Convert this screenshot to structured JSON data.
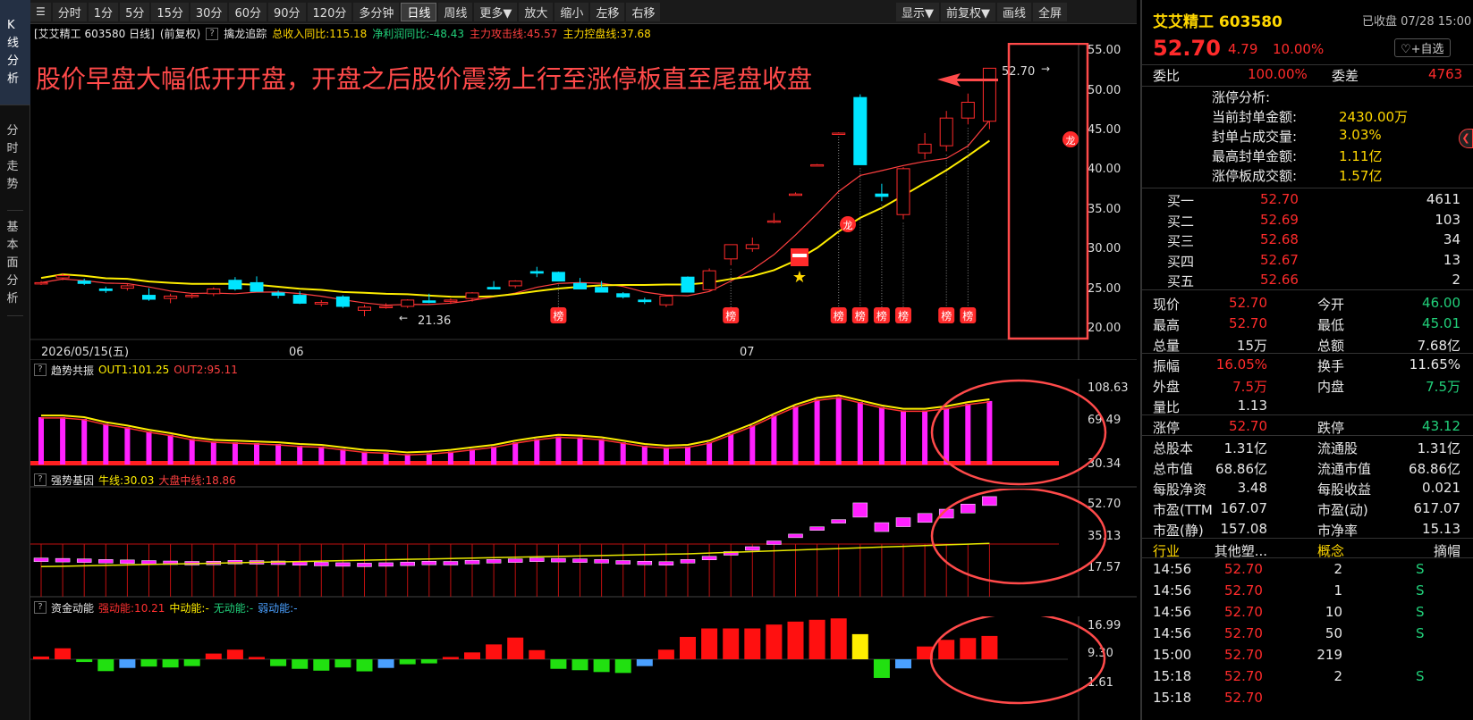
{
  "sidebar": {
    "tabs": [
      "K线分析",
      "分时走势",
      "基本面分析"
    ]
  },
  "toolbar": {
    "left": [
      "分时",
      "1分",
      "5分",
      "15分",
      "30分",
      "60分",
      "90分",
      "120分",
      "多分钟",
      "日线",
      "周线",
      "更多▼",
      "放大",
      "缩小",
      "左移",
      "右移"
    ],
    "active": "日线",
    "right": [
      "显示▼",
      "前复权▼",
      "画线",
      "全屏"
    ]
  },
  "info": {
    "title": "[艾艾精工 603580 日线]",
    "fq": "(前复权)",
    "indicator": "擒龙追踪",
    "rev": "总收入同比:115.18",
    "profit": "净利润同比:-48.43",
    "attack": "主力攻击线:45.57",
    "control": "主力控盘线:37.68"
  },
  "annotation": "股价早盘大幅低开开盘，开盘之后股价震荡上行至涨停板直至尾盘收盘",
  "main_chart": {
    "yaxis": [
      "55.00",
      "50.00",
      "45.00",
      "40.00",
      "35.00",
      "30.00",
      "25.00",
      "20.00"
    ],
    "date": "2026/05/15(五)",
    "months": [
      "06",
      "07"
    ],
    "high_label": "52.70",
    "low_label": "21.36",
    "badge": "榜"
  },
  "panel1": {
    "name": "趋势共振",
    "out1": "OUT1:101.25",
    "out2": "OUT2:95.11",
    "yaxis": [
      "108.63",
      "69.49",
      "30.34"
    ]
  },
  "panel2": {
    "name": "强势基因",
    "bull": "牛线:30.03",
    "mid": "大盘中线:18.86",
    "yaxis": [
      "52.70",
      "35.13",
      "17.57"
    ]
  },
  "panel3": {
    "name": "资金动能",
    "strong": "强动能:10.21",
    "medium": "中动能:-",
    "none": "无动能:-",
    "weak": "弱动能:-",
    "yaxis": [
      "16.99",
      "9.30",
      "1.61"
    ]
  },
  "chart_data": {
    "type": "candlestick",
    "candles": [
      [
        25.5,
        25.8,
        25.3,
        25.6
      ],
      [
        26.2,
        26.8,
        25.9,
        26.5
      ],
      [
        25.8,
        26.1,
        25.3,
        25.5
      ],
      [
        24.8,
        25.1,
        24.3,
        24.6
      ],
      [
        24.9,
        25.4,
        24.6,
        25.2
      ],
      [
        24.0,
        24.9,
        23.3,
        23.5
      ],
      [
        23.6,
        24.2,
        23.0,
        23.9
      ],
      [
        23.9,
        24.3,
        23.6,
        24.0
      ],
      [
        24.2,
        25.0,
        23.9,
        24.8
      ],
      [
        25.9,
        26.3,
        24.6,
        24.8
      ],
      [
        25.6,
        26.4,
        24.5,
        24.5
      ],
      [
        24.3,
        24.6,
        23.6,
        24.0
      ],
      [
        24.0,
        24.5,
        22.9,
        23.0
      ],
      [
        22.9,
        23.4,
        22.6,
        23.1
      ],
      [
        23.8,
        24.0,
        22.4,
        22.6
      ],
      [
        22.1,
        22.8,
        21.36,
        22.5
      ],
      [
        22.5,
        23.0,
        22.3,
        22.6
      ],
      [
        22.6,
        23.5,
        22.4,
        23.4
      ],
      [
        23.3,
        24.2,
        23.0,
        23.1
      ],
      [
        23.3,
        23.6,
        22.9,
        23.4
      ],
      [
        23.6,
        24.4,
        23.2,
        24.3
      ],
      [
        25.0,
        25.8,
        24.8,
        24.8
      ],
      [
        25.2,
        25.9,
        24.9,
        25.8
      ],
      [
        27.0,
        27.6,
        26.3,
        26.8
      ],
      [
        26.9,
        27.0,
        25.8,
        25.8
      ],
      [
        25.5,
        26.2,
        24.8,
        24.8
      ],
      [
        25.0,
        25.8,
        24.4,
        24.4
      ],
      [
        24.2,
        24.4,
        23.6,
        23.8
      ],
      [
        23.4,
        23.7,
        22.9,
        23.2
      ],
      [
        22.8,
        24.0,
        22.5,
        23.9
      ],
      [
        26.3,
        26.4,
        24.4,
        24.4
      ],
      [
        24.7,
        27.4,
        24.6,
        27.1
      ],
      [
        28.6,
        30.4,
        27.8,
        30.4
      ],
      [
        29.9,
        31.3,
        29.5,
        30.4
      ],
      [
        33.4,
        34.4,
        33.1,
        33.4
      ],
      [
        36.8,
        37.0,
        36.8,
        36.8
      ],
      [
        40.5,
        40.6,
        40.5,
        40.5
      ],
      [
        44.5,
        44.6,
        44.5,
        44.5
      ],
      [
        49.0,
        49.4,
        40.5,
        40.5
      ],
      [
        36.8,
        38.1,
        35.9,
        36.5
      ],
      [
        34.2,
        40.2,
        33.6,
        40.0
      ],
      [
        42.0,
        44.5,
        41.2,
        43.1
      ],
      [
        42.9,
        47.3,
        42.2,
        46.4
      ],
      [
        46.4,
        49.5,
        45.6,
        48.4
      ],
      [
        46.0,
        52.7,
        45.01,
        52.7
      ]
    ],
    "badges": [
      24,
      32,
      37,
      38,
      39,
      40,
      42,
      43
    ],
    "trend": [
      82,
      82,
      80,
      74,
      70,
      65,
      61,
      56,
      53,
      52,
      51,
      50,
      48,
      47,
      44,
      41,
      40,
      38,
      39,
      41,
      44,
      47,
      52,
      56,
      59,
      58,
      56,
      52,
      48,
      46,
      47,
      52,
      62,
      72,
      84,
      95,
      103,
      106,
      100,
      94,
      90,
      90,
      93,
      98,
      101.25
    ],
    "gene": [
      25.2,
      25.0,
      24.8,
      24.5,
      24.3,
      24.0,
      23.8,
      23.6,
      23.7,
      24.1,
      24.0,
      23.8,
      23.5,
      23.2,
      23.0,
      22.8,
      23.0,
      23.3,
      23.7,
      23.6,
      24.1,
      24.5,
      24.8,
      25.2,
      25.0,
      24.8,
      24.5,
      24.0,
      23.7,
      23.5,
      24.5,
      26.0,
      28.2,
      30.5,
      33.2,
      36.4,
      39.8,
      43.2,
      48.5,
      40.5,
      42.8,
      44.8,
      46.8,
      49.2,
      52.7
    ],
    "flow": [
      1.2,
      4.8,
      -1.2,
      -5.2,
      -3.8,
      -3.2,
      -3.6,
      -3.0,
      2.5,
      4.2,
      1.0,
      -3.0,
      -4.2,
      -5.0,
      -3.6,
      -5.3,
      -3.8,
      -2.2,
      -1.8,
      1.0,
      3.0,
      6.5,
      9.5,
      4.0,
      -4.2,
      -4.8,
      -5.6,
      -6.0,
      -3.0,
      4.2,
      9.8,
      13.5,
      13.5,
      13.5,
      15.2,
      16.5,
      17.3,
      17.9,
      11.0,
      -8.2,
      -4.0,
      5.6,
      8.5,
      9.3,
      10.21
    ]
  }
}
